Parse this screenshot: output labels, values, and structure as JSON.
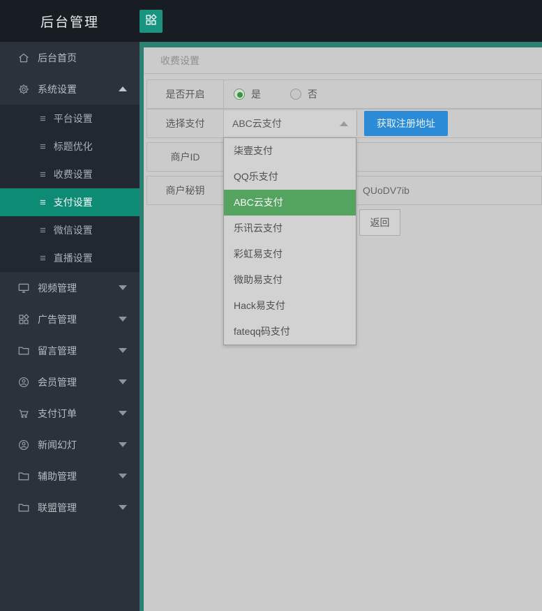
{
  "header": {
    "title": "后台管理",
    "grid_button_icon": "app-grid-icon"
  },
  "sidebar": {
    "home": {
      "label": "后台首页",
      "icon": "home-icon"
    },
    "system": {
      "label": "系统设置",
      "icon": "gear-icon",
      "state": "expanded"
    },
    "submenu": [
      {
        "label": "平台设置",
        "active": false
      },
      {
        "label": "标题优化",
        "active": false
      },
      {
        "label": "收费设置",
        "active": false
      },
      {
        "label": "支付设置",
        "active": true
      },
      {
        "label": "微信设置",
        "active": false
      },
      {
        "label": "直播设置",
        "active": false
      }
    ],
    "groups": [
      {
        "label": "视频管理",
        "icon": "monitor-icon"
      },
      {
        "label": "广告管理",
        "icon": "grid-icon"
      },
      {
        "label": "留言管理",
        "icon": "folder-icon"
      },
      {
        "label": "会员管理",
        "icon": "user-circle-icon"
      },
      {
        "label": "支付订单",
        "icon": "cart-icon"
      },
      {
        "label": "新闻幻灯",
        "icon": "user-circle-icon"
      },
      {
        "label": "辅助管理",
        "icon": "folder-icon"
      },
      {
        "label": "联盟管理",
        "icon": "folder-icon"
      }
    ]
  },
  "main": {
    "page_title": "收费设置",
    "form": {
      "enable_label": "是否开启",
      "radio_yes": "是",
      "radio_no": "否",
      "radio_selected": "是",
      "pay_select_label": "选择支付",
      "pay_select_value": "ABC云支付",
      "register_button": "获取注册地址",
      "merchant_id_label": "商户ID",
      "merchant_id_visible_value": "",
      "merchant_key_label": "商户秘钥",
      "merchant_key_visible_value": "QUoDV7ib",
      "back_button": "返回"
    },
    "dropdown": {
      "options": [
        "柒壹支付",
        "QQ乐支付",
        "ABC云支付",
        "乐讯云支付",
        "彩虹易支付",
        "微助易支付",
        "Hack易支付",
        "fateqq码支付"
      ],
      "selected": "ABC云支付"
    }
  },
  "colors": {
    "accent_teal": "#0e8b74",
    "accent_green": "#54a35f",
    "accent_blue": "#2c8bd6",
    "header_bg": "#181d24",
    "sidebar_bg": "#2b323b"
  }
}
